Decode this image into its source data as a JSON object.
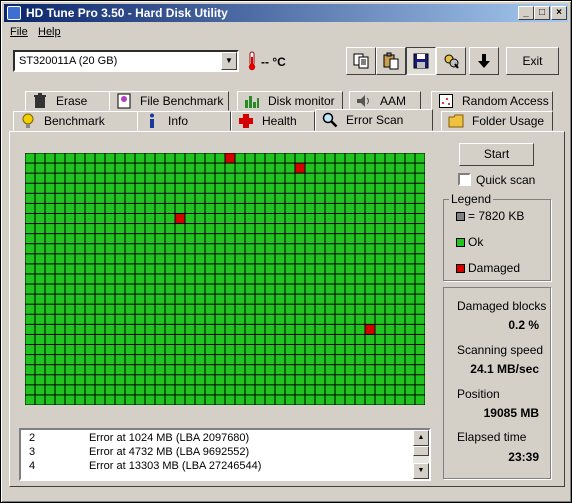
{
  "window": {
    "title": "HD Tune Pro 3.50 - Hard Disk Utility"
  },
  "menu": {
    "file": "File",
    "help": "Help"
  },
  "toolbar": {
    "drive": "ST320011A (20 GB)",
    "temperature": "-- °C",
    "icons": [
      "copy-icon",
      "paste-icon",
      "save-icon",
      "options-icon",
      "download-icon"
    ],
    "exit_label": "Exit"
  },
  "tabs": {
    "row1": [
      "Erase",
      "File Benchmark",
      "Disk monitor",
      "AAM",
      "Random Access"
    ],
    "row2": [
      "Benchmark",
      "Info",
      "Health",
      "Error Scan",
      "Folder Usage"
    ],
    "active": "Error Scan"
  },
  "scan": {
    "start_label": "Start",
    "quick_scan_label": "Quick scan",
    "quick_scan_checked": false,
    "columns": 40,
    "rows": 25,
    "damaged_cells": [
      [
        20,
        0
      ],
      [
        27,
        1
      ],
      [
        15,
        6
      ],
      [
        34,
        17
      ]
    ],
    "ok_color": "#21c321",
    "damaged_color": "#d40000",
    "block_color": "#808080"
  },
  "legend": {
    "title": "Legend",
    "block_size": "= 7820 KB",
    "ok": "Ok",
    "damaged": "Damaged"
  },
  "stats": {
    "damaged_blocks_label": "Damaged blocks",
    "damaged_blocks_value": "0.2 %",
    "speed_label": "Scanning speed",
    "speed_value": "24.1 MB/sec",
    "position_label": "Position",
    "position_value": "19085 MB",
    "elapsed_label": "Elapsed time",
    "elapsed_value": "23:39"
  },
  "log": [
    {
      "num": "2",
      "msg": "Error at 1024 MB (LBA 2097680)"
    },
    {
      "num": "3",
      "msg": "Error at 4732 MB (LBA 9692552)"
    },
    {
      "num": "4",
      "msg": "Error at 13303 MB (LBA 27246544)"
    }
  ]
}
